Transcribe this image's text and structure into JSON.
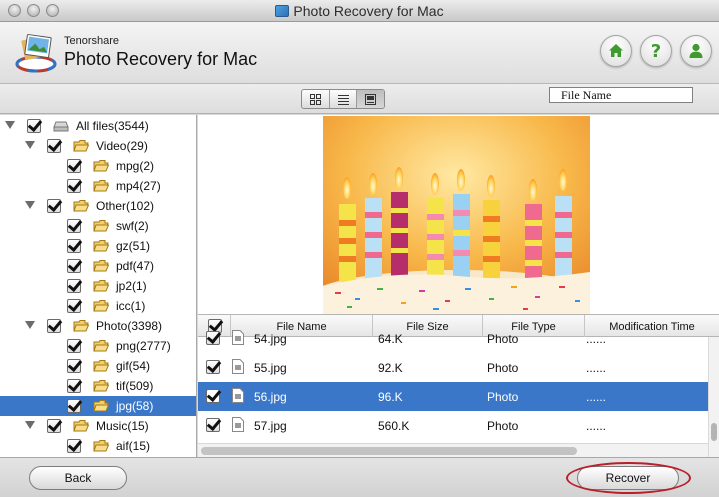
{
  "window": {
    "title": "Photo Recovery for Mac"
  },
  "header": {
    "brand": "Tenorshare",
    "product": "Photo Recovery for Mac",
    "home_icon": "home-icon",
    "help_label": "?",
    "account_icon": "user-icon"
  },
  "toolbar": {
    "view_modes": [
      "grid-view-icon",
      "list-view-icon",
      "preview-view-icon"
    ],
    "active_view": "preview-view-icon",
    "search_value": "File Name"
  },
  "tree": [
    {
      "label": "All files(3544)",
      "level": 0,
      "kind": "drive",
      "expanded": true,
      "checked": true
    },
    {
      "label": "Video(29)",
      "level": 1,
      "kind": "folder",
      "expanded": true,
      "checked": true
    },
    {
      "label": "mpg(2)",
      "level": 2,
      "kind": "folder",
      "checked": true
    },
    {
      "label": "mp4(27)",
      "level": 2,
      "kind": "folder",
      "checked": true
    },
    {
      "label": "Other(102)",
      "level": 1,
      "kind": "folder",
      "expanded": true,
      "checked": true
    },
    {
      "label": "swf(2)",
      "level": 2,
      "kind": "folder",
      "checked": true
    },
    {
      "label": "gz(51)",
      "level": 2,
      "kind": "folder",
      "checked": true
    },
    {
      "label": "pdf(47)",
      "level": 2,
      "kind": "folder",
      "checked": true
    },
    {
      "label": "jp2(1)",
      "level": 2,
      "kind": "folder",
      "checked": true
    },
    {
      "label": "icc(1)",
      "level": 2,
      "kind": "folder",
      "checked": true
    },
    {
      "label": "Photo(3398)",
      "level": 1,
      "kind": "folder",
      "expanded": true,
      "checked": true
    },
    {
      "label": "png(2777)",
      "level": 2,
      "kind": "folder",
      "checked": true
    },
    {
      "label": "gif(54)",
      "level": 2,
      "kind": "folder",
      "checked": true
    },
    {
      "label": "tif(509)",
      "level": 2,
      "kind": "folder",
      "checked": true
    },
    {
      "label": "jpg(58)",
      "level": 2,
      "kind": "folder",
      "checked": true,
      "selected": true
    },
    {
      "label": "Music(15)",
      "level": 1,
      "kind": "folder",
      "expanded": true,
      "checked": true
    },
    {
      "label": "aif(15)",
      "level": 2,
      "kind": "folder",
      "checked": true
    }
  ],
  "table": {
    "columns": [
      "File Name",
      "File Size",
      "File Type",
      "Modification Time"
    ],
    "rows": [
      {
        "name": "54.jpg",
        "size": "64.K",
        "type": "Photo",
        "time": "......"
      },
      {
        "name": "55.jpg",
        "size": "92.K",
        "type": "Photo",
        "time": "......"
      },
      {
        "name": "56.jpg",
        "size": "96.K",
        "type": "Photo",
        "time": "......",
        "selected": true
      },
      {
        "name": "57.jpg",
        "size": "560.K",
        "type": "Photo",
        "time": "......"
      }
    ]
  },
  "footer": {
    "back_label": "Back",
    "recover_label": "Recover"
  },
  "colors": {
    "selection": "#3a77c9",
    "accent_green": "#3f9a2f",
    "highlight_ring": "#b8202a"
  }
}
